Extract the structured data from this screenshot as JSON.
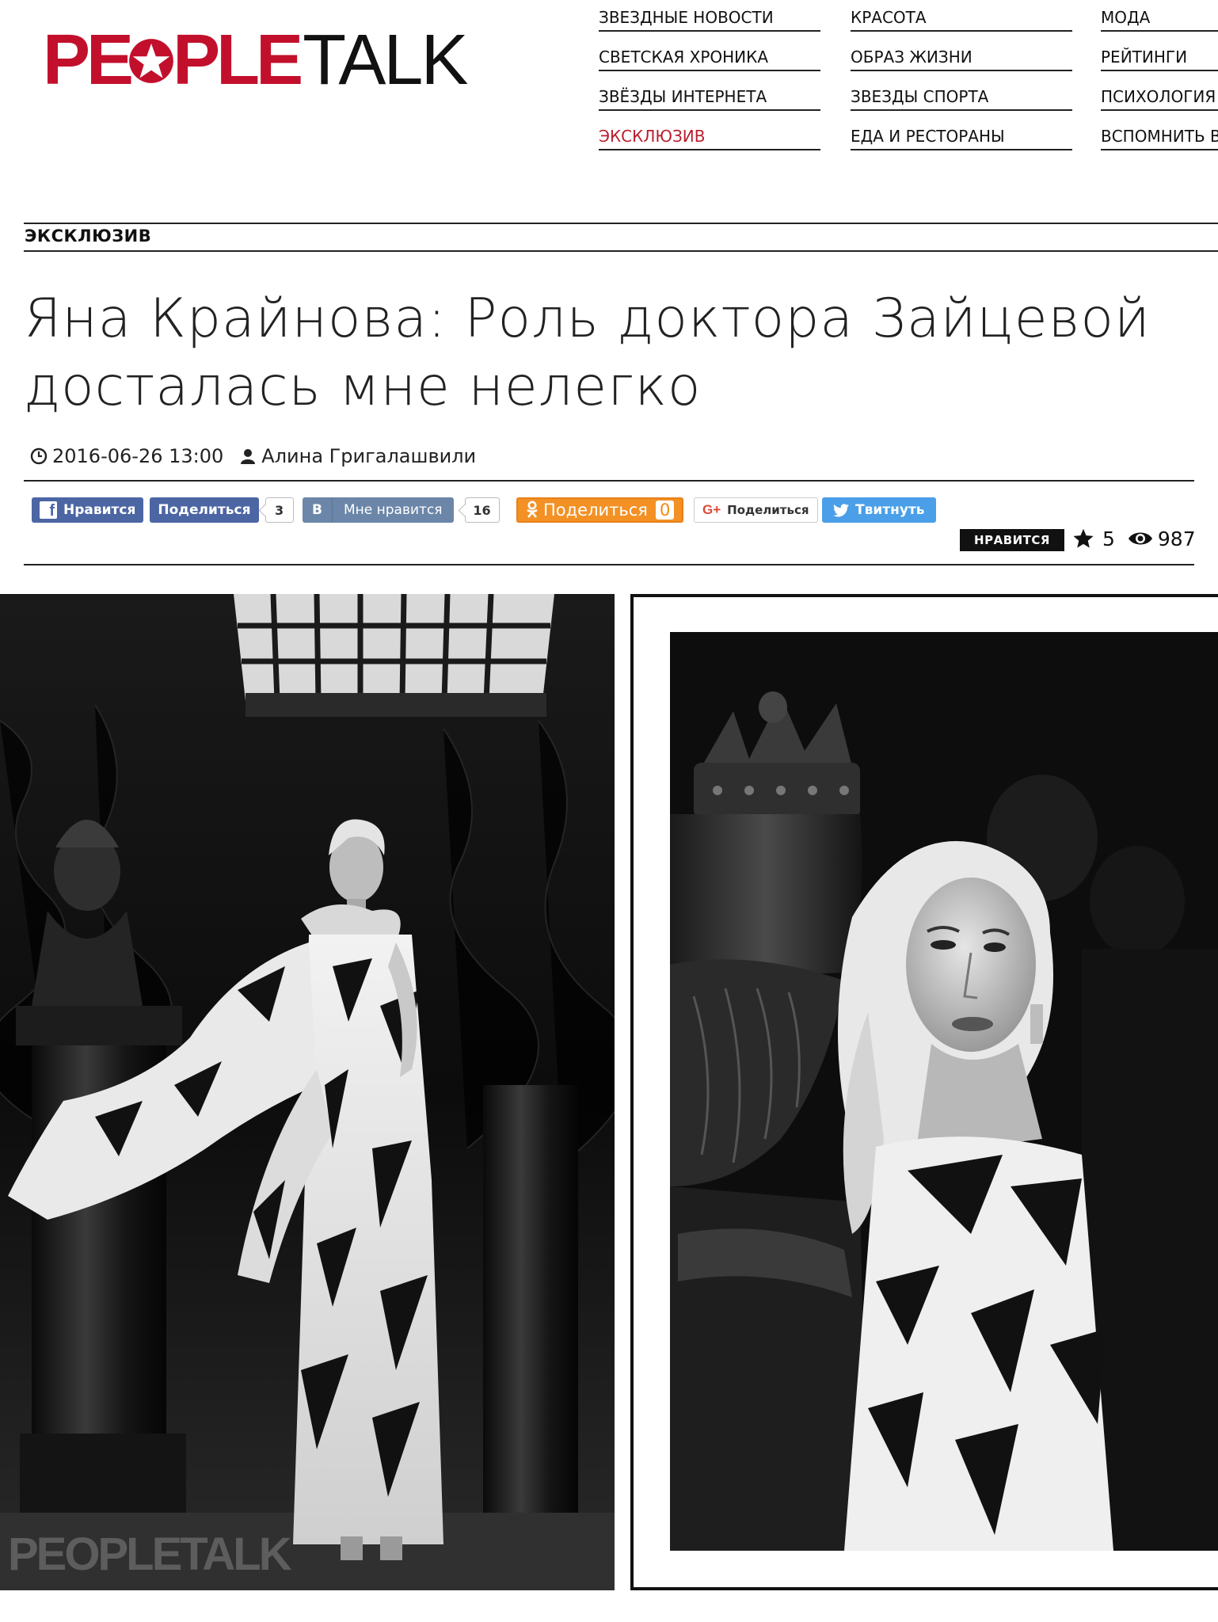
{
  "logo": {
    "people": "PE",
    "people_after_star": "PLE",
    "talk": "TALK",
    "brand_red": "#c2102c"
  },
  "nav": {
    "col1": [
      "ЗВЕЗДНЫЕ НОВОСТИ",
      "СВЕТСКАЯ ХРОНИКА",
      "ЗВЁЗДЫ ИНТЕРНЕТА",
      "ЭКСКЛЮЗИВ"
    ],
    "col2": [
      "КРАСОТА",
      "ОБРАЗ ЖИЗНИ",
      "ЗВЕЗДЫ СПОРТА",
      "ЕДА И РЕСТОРАНЫ"
    ],
    "col3": [
      "МОДА",
      "РЕЙТИНГИ",
      "ПСИХОЛОГИЯ",
      "ВСПОМНИТЬ ВСЁ"
    ],
    "active": "ЭКСКЛЮЗИВ",
    "active_color": "#b81e2e"
  },
  "section": "ЭКСКЛЮЗИВ",
  "article": {
    "title_line1": "Яна Крайнова: Роль доктора Зайцевой",
    "title_line2": "досталась мне нелегко",
    "date": "2016-06-26 13:00",
    "author": "Алина Григалашвили",
    "date_icon": "clock-icon",
    "author_icon": "user-icon"
  },
  "share": {
    "fb_like": "Нравится",
    "fb_share": "Поделиться",
    "fb_count": "3",
    "vk_letter": "В",
    "vk_like": "Мне нравится",
    "vk_count": "16",
    "ok_share": "Поделиться",
    "ok_count": "0",
    "gplus_share": "Поделиться",
    "twitter": "Твитнуть"
  },
  "rating": {
    "like_label": "НРАВИТСЯ",
    "stars": "5",
    "views": "987",
    "star_icon": "star-icon",
    "views_icon": "eye-icon"
  },
  "photos": {
    "watermark": "PEOPLETALK"
  }
}
